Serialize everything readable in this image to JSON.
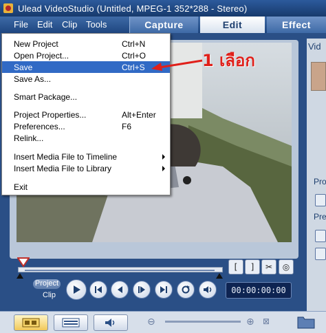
{
  "window": {
    "title": "Ulead VideoStudio (Untitled, MPEG-1 352*288 - Stereo)"
  },
  "menubar": {
    "items": [
      "File",
      "Edit",
      "Clip",
      "Tools"
    ]
  },
  "mode_tabs": {
    "capture": "Capture",
    "edit": "Edit",
    "effect": "Effect",
    "active": "Edit"
  },
  "file_menu": {
    "items": [
      {
        "label": "New Project",
        "shortcut": "Ctrl+N"
      },
      {
        "label": "Open Project...",
        "shortcut": "Ctrl+O"
      },
      {
        "label": "Save",
        "shortcut": "Ctrl+S",
        "highlighted": true
      },
      {
        "label": "Save As...",
        "shortcut": ""
      },
      {
        "label": "Smart Package...",
        "shortcut": ""
      },
      {
        "label": "Project Properties...",
        "shortcut": "Alt+Enter"
      },
      {
        "label": "Preferences...",
        "shortcut": "F6"
      },
      {
        "label": "Relink...",
        "shortcut": ""
      },
      {
        "label": "Insert Media File to Timeline",
        "shortcut": "",
        "submenu": true
      },
      {
        "label": "Insert Media File to Library",
        "shortcut": "",
        "submenu": true
      },
      {
        "label": "Exit",
        "shortcut": ""
      }
    ]
  },
  "annotation": {
    "text": "1 เลือก",
    "color": "#e0201a"
  },
  "right_panel": {
    "label_top": "Vid",
    "label_mid_1": "Pro",
    "label_mid_2": "Pre"
  },
  "playback": {
    "project_label": "Project",
    "clip_label": "Clip",
    "timecode": "00:00:00:00",
    "buttons": [
      "play-icon",
      "home-icon",
      "previous-icon",
      "next-icon",
      "end-icon",
      "repeat-icon",
      "volume-icon"
    ]
  },
  "bottom_bar": {
    "views": [
      "storyboard-view-icon",
      "timeline-view-icon",
      "audio-view-icon"
    ],
    "active_view": "storyboard-view-icon"
  },
  "colors": {
    "titlebar": "#173a6c",
    "menu_highlight": "#316ac5",
    "annotation": "#e0201a"
  }
}
